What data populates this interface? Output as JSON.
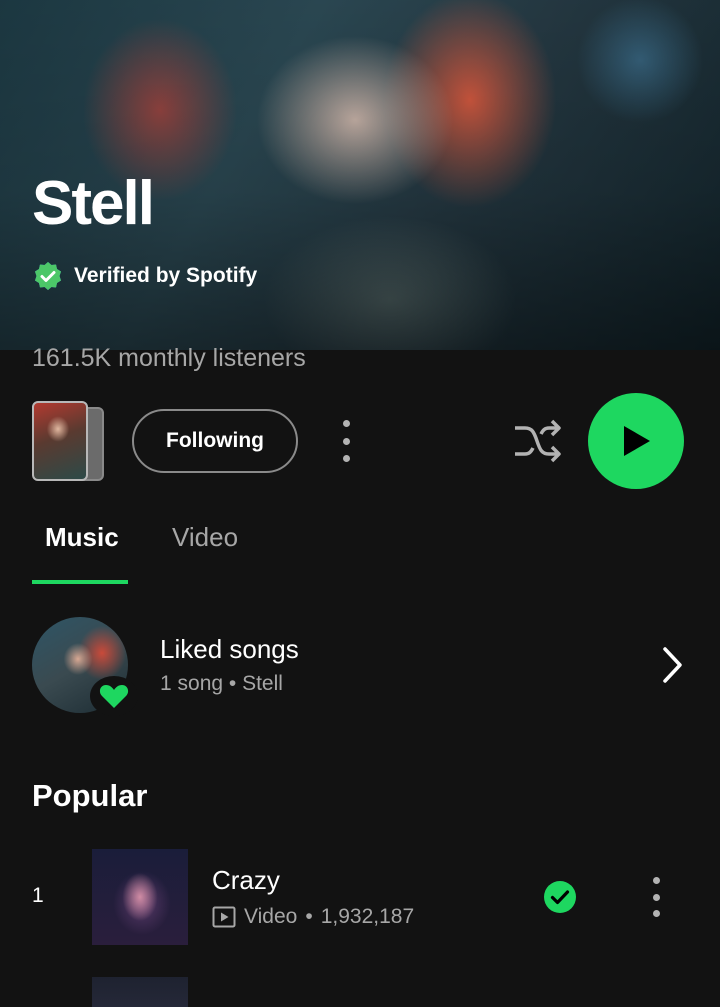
{
  "artist": {
    "name": "Stell",
    "verified_label": "Verified by Spotify",
    "monthly_listeners": "161.5K monthly listeners"
  },
  "actions": {
    "follow_label": "Following",
    "more_icon": "more-vertical-icon",
    "shuffle_icon": "shuffle-icon",
    "play_icon": "play-icon"
  },
  "tabs": [
    {
      "label": "Music",
      "selected": true
    },
    {
      "label": "Video",
      "selected": false
    }
  ],
  "liked_songs": {
    "title": "Liked songs",
    "subtitle": "1 song • Stell"
  },
  "popular": {
    "title": "Popular",
    "tracks": [
      {
        "rank": "1",
        "title": "Crazy",
        "type": "Video",
        "plays": "1,932,187",
        "downloaded": true
      }
    ]
  },
  "colors": {
    "accent": "#1ed760",
    "background": "#121212",
    "secondary_text": "#a7a7a7"
  }
}
